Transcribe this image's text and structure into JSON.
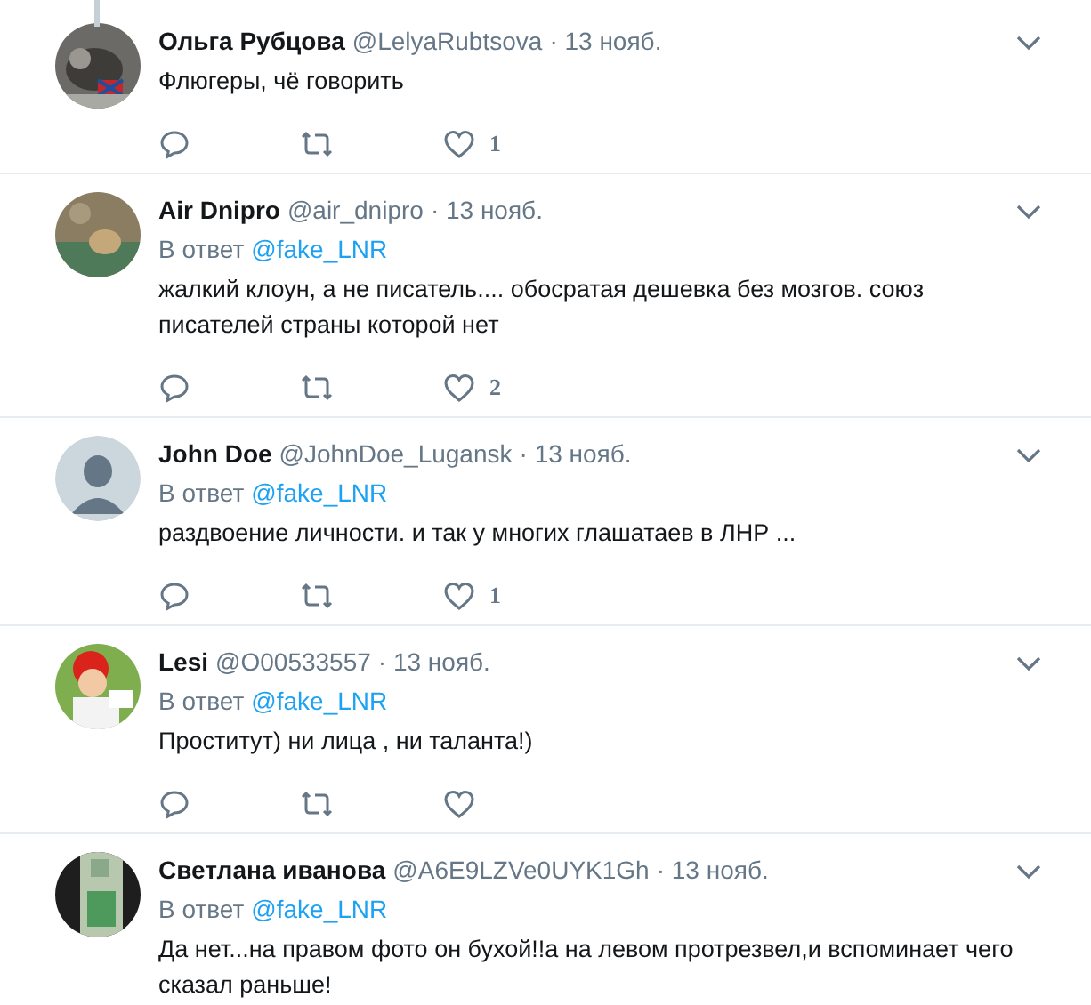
{
  "tweets": [
    {
      "name": "Ольга Рубцова",
      "handle": "@LelyaRubtsova",
      "date": "· 13 нояб.",
      "thread_above": true,
      "text": "Флюгеры, чё говорить",
      "actions": true,
      "likes": "1"
    },
    {
      "name": "Air Dnipro",
      "handle": "@air_dnipro",
      "date": "· 13 нояб.",
      "thread_above": false,
      "reply_label": "В ответ",
      "reply_to": "@fake_LNR",
      "text": "жалкий клоун, а не писатель.... обосратая дешевка без мозгов.  союз писателей страны которой нет",
      "actions": true,
      "likes": "2"
    },
    {
      "name": "John Doe",
      "handle": "@JohnDoe_Lugansk",
      "date": "· 13 нояб.",
      "thread_above": false,
      "reply_label": "В ответ",
      "reply_to": "@fake_LNR",
      "text": "раздвоение личности. и так у многих глашатаев в ЛНР ...",
      "actions": true,
      "likes": "1"
    },
    {
      "name": "Lesi",
      "handle": "@O00533557",
      "date": "· 13 нояб.",
      "thread_above": false,
      "reply_label": "В ответ",
      "reply_to": "@fake_LNR",
      "text": "Проститут) ни лица , ни таланта!)",
      "actions": true
    },
    {
      "name": "Светлана иванова",
      "handle": "@A6E9LZVe0UYK1Gh",
      "date": "· 13 нояб.",
      "thread_above": false,
      "reply_label": "В ответ",
      "reply_to": "@fake_LNR",
      "text": "Да нет...на правом фото он бухой!!а на левом протрезвел,и вспоминает чего сказал раньше!",
      "actions": false
    }
  ]
}
